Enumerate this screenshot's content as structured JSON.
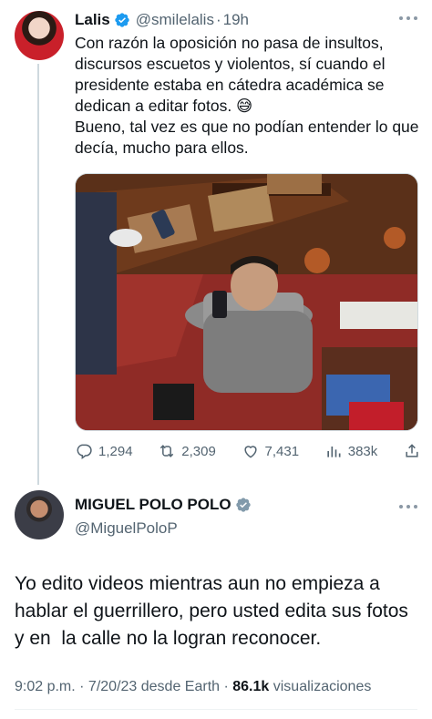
{
  "tweet1": {
    "name": "Lalis",
    "handle": "@smilelalis",
    "separator": "·",
    "time": "19h",
    "text": "Con razón la oposición no pasa de insultos, discursos escuetos y violentos, sí cuando el presidente estaba en cátedra académica se dedican a editar fotos. 😅\nBueno, tal vez es que no podían entender lo que decía, mucho para ellos.",
    "stats": {
      "replies": "1,294",
      "retweets": "2,309",
      "likes": "7,431",
      "views": "383k"
    }
  },
  "tweet2": {
    "name": "MIGUEL POLO POLO",
    "handle": "@MiguelPoloP",
    "text": "Yo edito videos mientras aun no empieza a hablar el guerrillero, pero usted edita sus fotos y en  la calle no la logran reconocer.",
    "meta": {
      "time_date": "9:02 p.m. · 7/20/23 desde Earth · ",
      "views_count": "86.1k",
      "views_label": " visualizaciones"
    }
  },
  "colors": {
    "verified": "#1d9bf0",
    "secondary_text": "#536471",
    "thread_line": "#cfd9de"
  },
  "icons": [
    "verified-badge-icon",
    "more-icon",
    "reply-icon",
    "retweet-icon",
    "like-icon",
    "views-icon",
    "share-icon"
  ]
}
